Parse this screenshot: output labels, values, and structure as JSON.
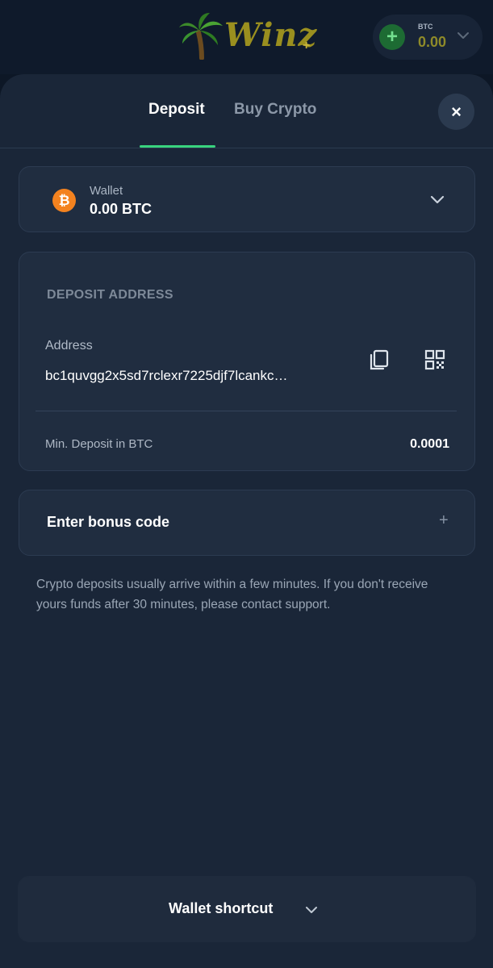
{
  "brand": {
    "name": "Winz",
    "suffix": "+"
  },
  "balance": {
    "currency": "BTC",
    "amount": "0.00",
    "add_icon": "plus-icon"
  },
  "tabs": [
    {
      "label": "Deposit",
      "active": true
    },
    {
      "label": "Buy Crypto",
      "active": false
    }
  ],
  "close_label": "×",
  "wallet": {
    "label": "Wallet",
    "value": "0.00 BTC",
    "icon": "bitcoin-icon",
    "icon_glyph": "₿"
  },
  "deposit": {
    "section_title": "DEPOSIT ADDRESS",
    "address_label": "Address",
    "address_value": "bc1quvgg2x5sd7rclexr7225djf7lcankc…",
    "min_label": "Min. Deposit in BTC",
    "min_value": "0.0001"
  },
  "bonus": {
    "label": "Enter bonus code",
    "action": "+"
  },
  "info": "Crypto deposits usually arrive within a few minutes. If you don't receive yours funds after 30 minutes, please contact support.",
  "shortcut": {
    "label": "Wallet shortcut"
  },
  "colors": {
    "accent_green": "#39d37e",
    "btc_orange": "#f3821f",
    "sheet_bg": "#1a2638",
    "card_bg": "#202d40"
  }
}
